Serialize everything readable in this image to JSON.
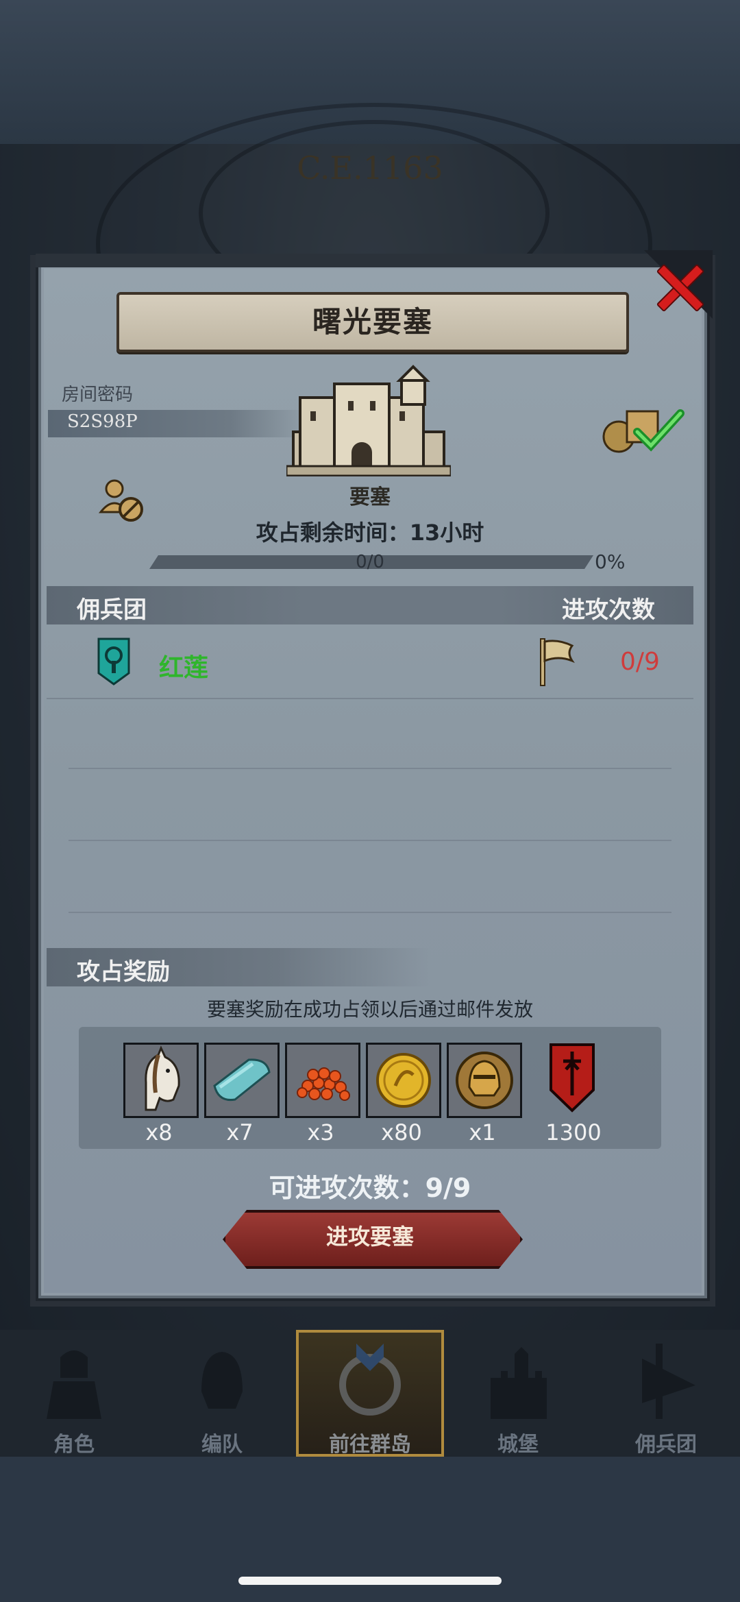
{
  "background": {
    "era_text": "C.E.1163"
  },
  "dialog": {
    "title": "曙光要塞",
    "room": {
      "label": "房间密码",
      "code": "S2S98P"
    },
    "building_label": "要塞",
    "timer_text": "攻占剩余时间：13小时",
    "progress": {
      "text": "0/0",
      "percent_text": "0%",
      "fraction": 0
    },
    "table": {
      "col_left": "佣兵团",
      "col_right": "进攻次数"
    },
    "mercenaries": [
      {
        "name": "红莲",
        "attacks": "0/9",
        "icon": "teal-banner-icon"
      }
    ],
    "rewards": {
      "title": "攻占奖励",
      "note": "要塞奖励在成功占领以后通过邮件发放",
      "items": [
        {
          "icon": "horse-icon",
          "qty": "x8"
        },
        {
          "icon": "cloth-icon",
          "qty": "x7"
        },
        {
          "icon": "caviar-icon",
          "qty": "x3"
        },
        {
          "icon": "gold-coin-icon",
          "qty": "x80"
        },
        {
          "icon": "helmet-coin-icon",
          "qty": "x1"
        },
        {
          "icon": "red-shield-emblem-icon",
          "qty": "1300"
        }
      ]
    },
    "remaining_attacks": "可进攻次数：9/9",
    "attack_button": "进攻要塞"
  },
  "nav": {
    "items": [
      {
        "label": "角色"
      },
      {
        "label": "编队"
      },
      {
        "label": "前往群岛",
        "active": true
      },
      {
        "label": "城堡"
      },
      {
        "label": "佣兵团"
      }
    ]
  },
  "colors": {
    "accent_red": "#cf3c3c",
    "merc_green": "#2fb52c",
    "active_nav": "#b08b3e"
  }
}
